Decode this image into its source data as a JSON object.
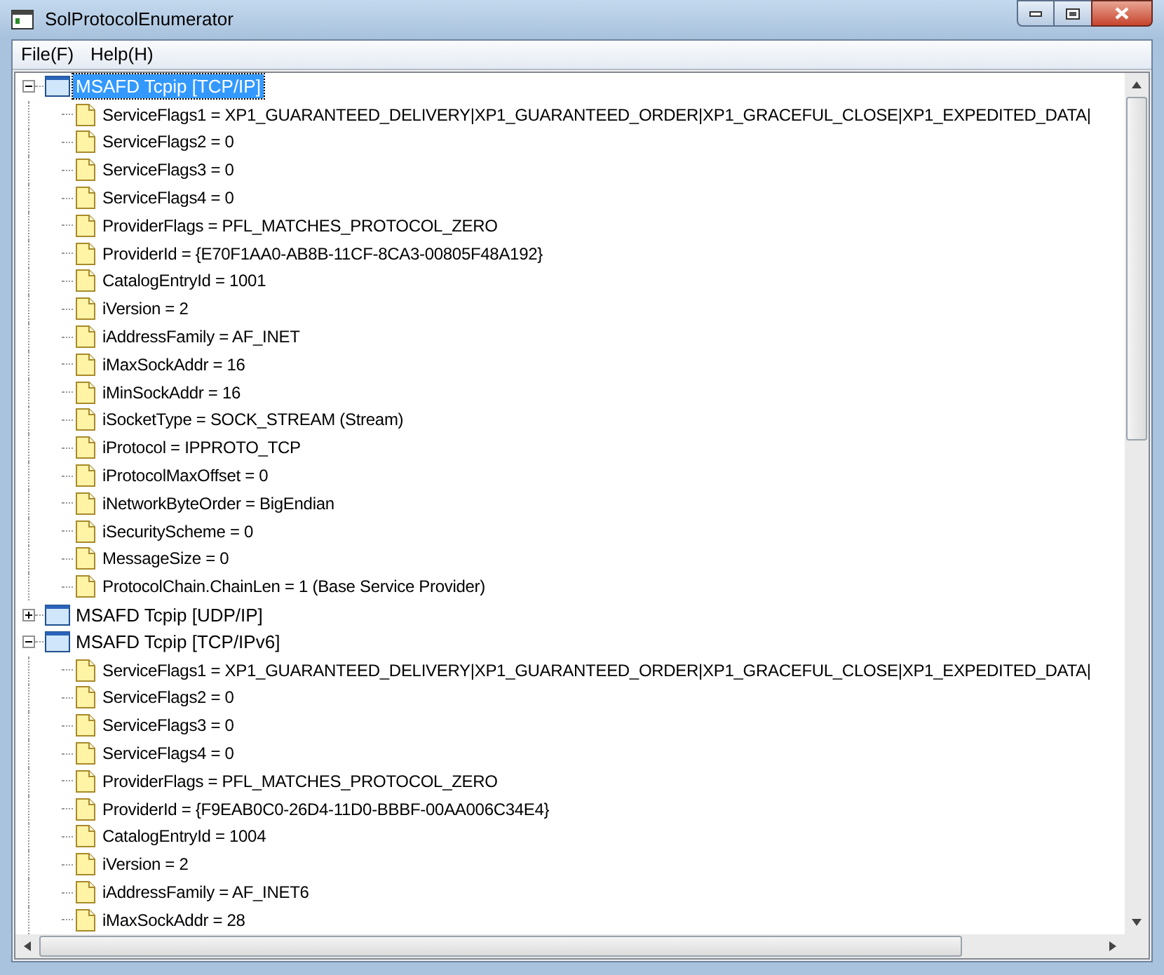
{
  "window": {
    "title": "SolProtocolEnumerator"
  },
  "menu": [
    {
      "label": "File(F)"
    },
    {
      "label": "Help(H)"
    }
  ],
  "tree": {
    "nodes": [
      {
        "label": "MSAFD Tcpip [TCP/IP]",
        "expanded": true,
        "selected": true,
        "children": [
          {
            "label": "ServiceFlags1 = XP1_GUARANTEED_DELIVERY|XP1_GUARANTEED_ORDER|XP1_GRACEFUL_CLOSE|XP1_EXPEDITED_DATA|"
          },
          {
            "label": "ServiceFlags2 = 0"
          },
          {
            "label": "ServiceFlags3 = 0"
          },
          {
            "label": "ServiceFlags4 = 0"
          },
          {
            "label": "ProviderFlags = PFL_MATCHES_PROTOCOL_ZERO"
          },
          {
            "label": "ProviderId = {E70F1AA0-AB8B-11CF-8CA3-00805F48A192}"
          },
          {
            "label": "CatalogEntryId = 1001"
          },
          {
            "label": "iVersion = 2"
          },
          {
            "label": "iAddressFamily = AF_INET"
          },
          {
            "label": "iMaxSockAddr = 16"
          },
          {
            "label": "iMinSockAddr = 16"
          },
          {
            "label": "iSocketType = SOCK_STREAM (Stream)"
          },
          {
            "label": "iProtocol = IPPROTO_TCP"
          },
          {
            "label": "iProtocolMaxOffset = 0"
          },
          {
            "label": "iNetworkByteOrder = BigEndian"
          },
          {
            "label": "iSecurityScheme = 0"
          },
          {
            "label": "MessageSize = 0"
          },
          {
            "label": "ProtocolChain.ChainLen = 1 (Base Service Provider)"
          }
        ]
      },
      {
        "label": "MSAFD Tcpip [UDP/IP]",
        "expanded": false,
        "selected": false
      },
      {
        "label": "MSAFD Tcpip [TCP/IPv6]",
        "expanded": true,
        "selected": false,
        "children": [
          {
            "label": "ServiceFlags1 = XP1_GUARANTEED_DELIVERY|XP1_GUARANTEED_ORDER|XP1_GRACEFUL_CLOSE|XP1_EXPEDITED_DATA|"
          },
          {
            "label": "ServiceFlags2 = 0"
          },
          {
            "label": "ServiceFlags3 = 0"
          },
          {
            "label": "ServiceFlags4 = 0"
          },
          {
            "label": "ProviderFlags = PFL_MATCHES_PROTOCOL_ZERO"
          },
          {
            "label": "ProviderId = {F9EAB0C0-26D4-11D0-BBBF-00AA006C34E4}"
          },
          {
            "label": "CatalogEntryId = 1004"
          },
          {
            "label": "iVersion = 2"
          },
          {
            "label": "iAddressFamily = AF_INET6"
          },
          {
            "label": "iMaxSockAddr = 28"
          }
        ]
      }
    ]
  }
}
